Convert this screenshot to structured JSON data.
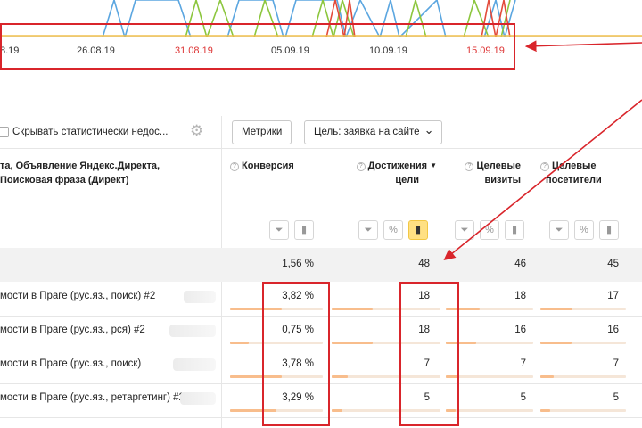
{
  "chart": {
    "date_labels": [
      {
        "text": "8.19",
        "weekend": false
      },
      {
        "text": "26.08.19",
        "weekend": false
      },
      {
        "text": "31.08.19",
        "weekend": true
      },
      {
        "text": "05.09.19",
        "weekend": false
      },
      {
        "text": "10.09.19",
        "weekend": false
      },
      {
        "text": "15.09.19",
        "weekend": true
      }
    ],
    "colors": {
      "series_a": "#5ba6e0",
      "series_b": "#8cc63e",
      "series_c": "#e34b3b",
      "series_d": "#f2c14e"
    }
  },
  "toolbar": {
    "hide_label": "Скрывать статистически недос...",
    "metrics_button": "Метрики",
    "goal_button": "Цель: заявка на сайте",
    "goal_caret": "⌄"
  },
  "table": {
    "header_left": {
      "line1": "та, Объявление Яндекс.Директа,",
      "line2": "Поисковая фраза (Директ)"
    },
    "columns": [
      {
        "id": "conversion",
        "line1": "Конверсия",
        "line2": ""
      },
      {
        "id": "goals",
        "line1": "Достижения",
        "line2": "цели",
        "sort": "▼"
      },
      {
        "id": "target_visits",
        "line1": "Целевые",
        "line2": "визиты"
      },
      {
        "id": "target_visitors",
        "line1": "Целевые",
        "line2": "посетители"
      }
    ],
    "totals": {
      "conversion": "1,56 %",
      "goals": "48",
      "target_visits": "46",
      "target_visitors": "45"
    },
    "rows": [
      {
        "label": "мости в Праге (рус.яз., поиск) #2",
        "conversion": "3,82 %",
        "goals": "18",
        "target_visits": "18",
        "target_visitors": "17",
        "fill": {
          "conversion": 0.56,
          "goals": 0.38,
          "target_visits": 0.39,
          "target_visitors": 0.38
        }
      },
      {
        "label": "мости в Праге (рус.яз., рся) #2",
        "conversion": "0,75 %",
        "goals": "18",
        "target_visits": "16",
        "target_visitors": "16",
        "fill": {
          "conversion": 0.2,
          "goals": 0.38,
          "target_visits": 0.35,
          "target_visitors": 0.36
        }
      },
      {
        "label": "мости в Праге (рус.яз., поиск)",
        "conversion": "3,78 %",
        "goals": "7",
        "target_visits": "7",
        "target_visitors": "7",
        "fill": {
          "conversion": 0.56,
          "goals": 0.15,
          "target_visits": 0.15,
          "target_visitors": 0.16
        }
      },
      {
        "label": "мости в Праге (рус.яз., ретаргетинг) #2",
        "conversion": "3,29 %",
        "goals": "5",
        "target_visits": "5",
        "target_visitors": "5",
        "fill": {
          "conversion": 0.5,
          "goals": 0.1,
          "target_visits": 0.11,
          "target_visitors": 0.11
        }
      }
    ]
  },
  "icons": {
    "gear": "gear-icon",
    "filter": "filter-icon",
    "percent": "percent-icon",
    "bars": "bar-chart-icon",
    "help": "help-icon"
  },
  "glyphs": {
    "help": "?",
    "percent": "%",
    "filter": "⏷",
    "bars": "▮"
  },
  "accent": {
    "annotation_red": "#d9252b",
    "active_yellow": "#ffe083",
    "bar_fill": "#f8bd8c"
  }
}
